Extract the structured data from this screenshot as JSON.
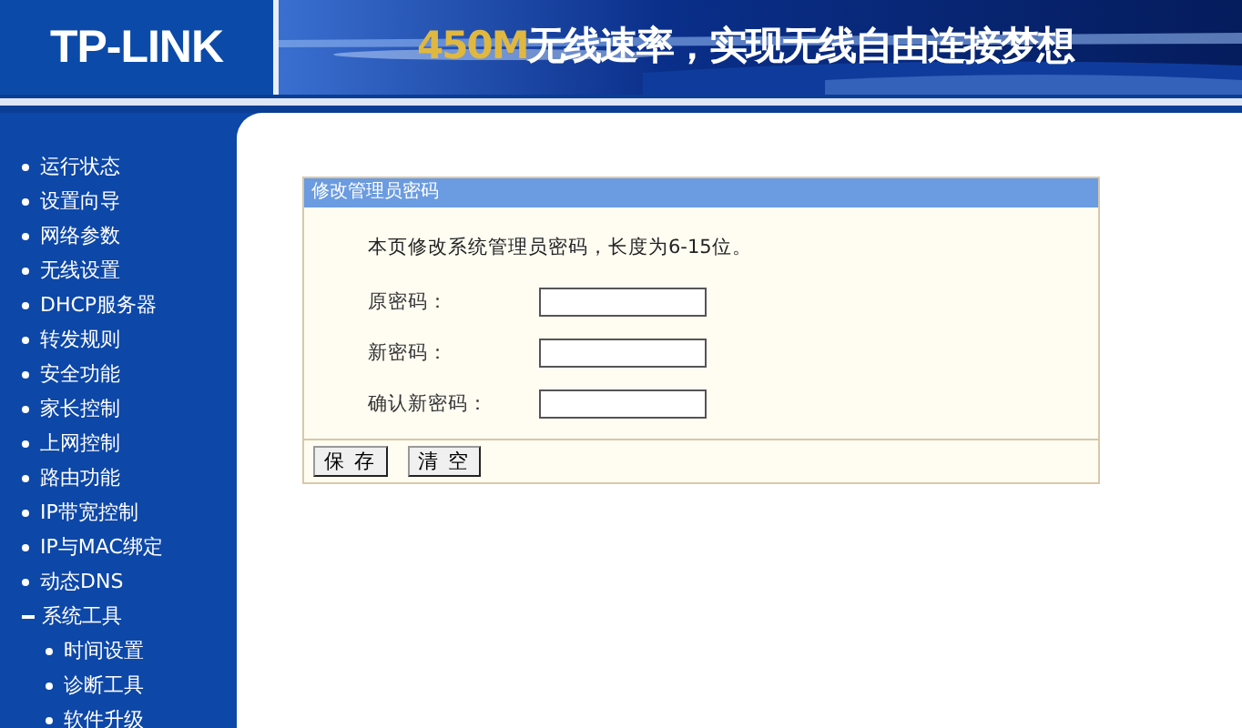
{
  "header": {
    "logo": "TP-LINK",
    "slogan_highlight": "450M",
    "slogan": "无线速率，实现无线自由连接梦想"
  },
  "sidebar": {
    "items": [
      {
        "label": "运行状态",
        "expanded": false
      },
      {
        "label": "设置向导",
        "expanded": false
      },
      {
        "label": "网络参数",
        "expanded": false
      },
      {
        "label": "无线设置",
        "expanded": false
      },
      {
        "label": "DHCP服务器",
        "expanded": false
      },
      {
        "label": "转发规则",
        "expanded": false
      },
      {
        "label": "安全功能",
        "expanded": false
      },
      {
        "label": "家长控制",
        "expanded": false
      },
      {
        "label": "上网控制",
        "expanded": false
      },
      {
        "label": "路由功能",
        "expanded": false
      },
      {
        "label": "IP带宽控制",
        "expanded": false
      },
      {
        "label": "IP与MAC绑定",
        "expanded": false
      },
      {
        "label": "动态DNS",
        "expanded": false
      },
      {
        "label": "系统工具",
        "expanded": true,
        "children": [
          {
            "label": "时间设置"
          },
          {
            "label": "诊断工具"
          },
          {
            "label": "软件升级"
          }
        ]
      }
    ]
  },
  "panel": {
    "title": "修改管理员密码",
    "description": "本页修改系统管理员密码，长度为6-15位。",
    "fields": [
      {
        "label": "原密码："
      },
      {
        "label": "新密码："
      },
      {
        "label": "确认新密码："
      }
    ],
    "buttons": [
      "保 存",
      "清 空"
    ]
  }
}
